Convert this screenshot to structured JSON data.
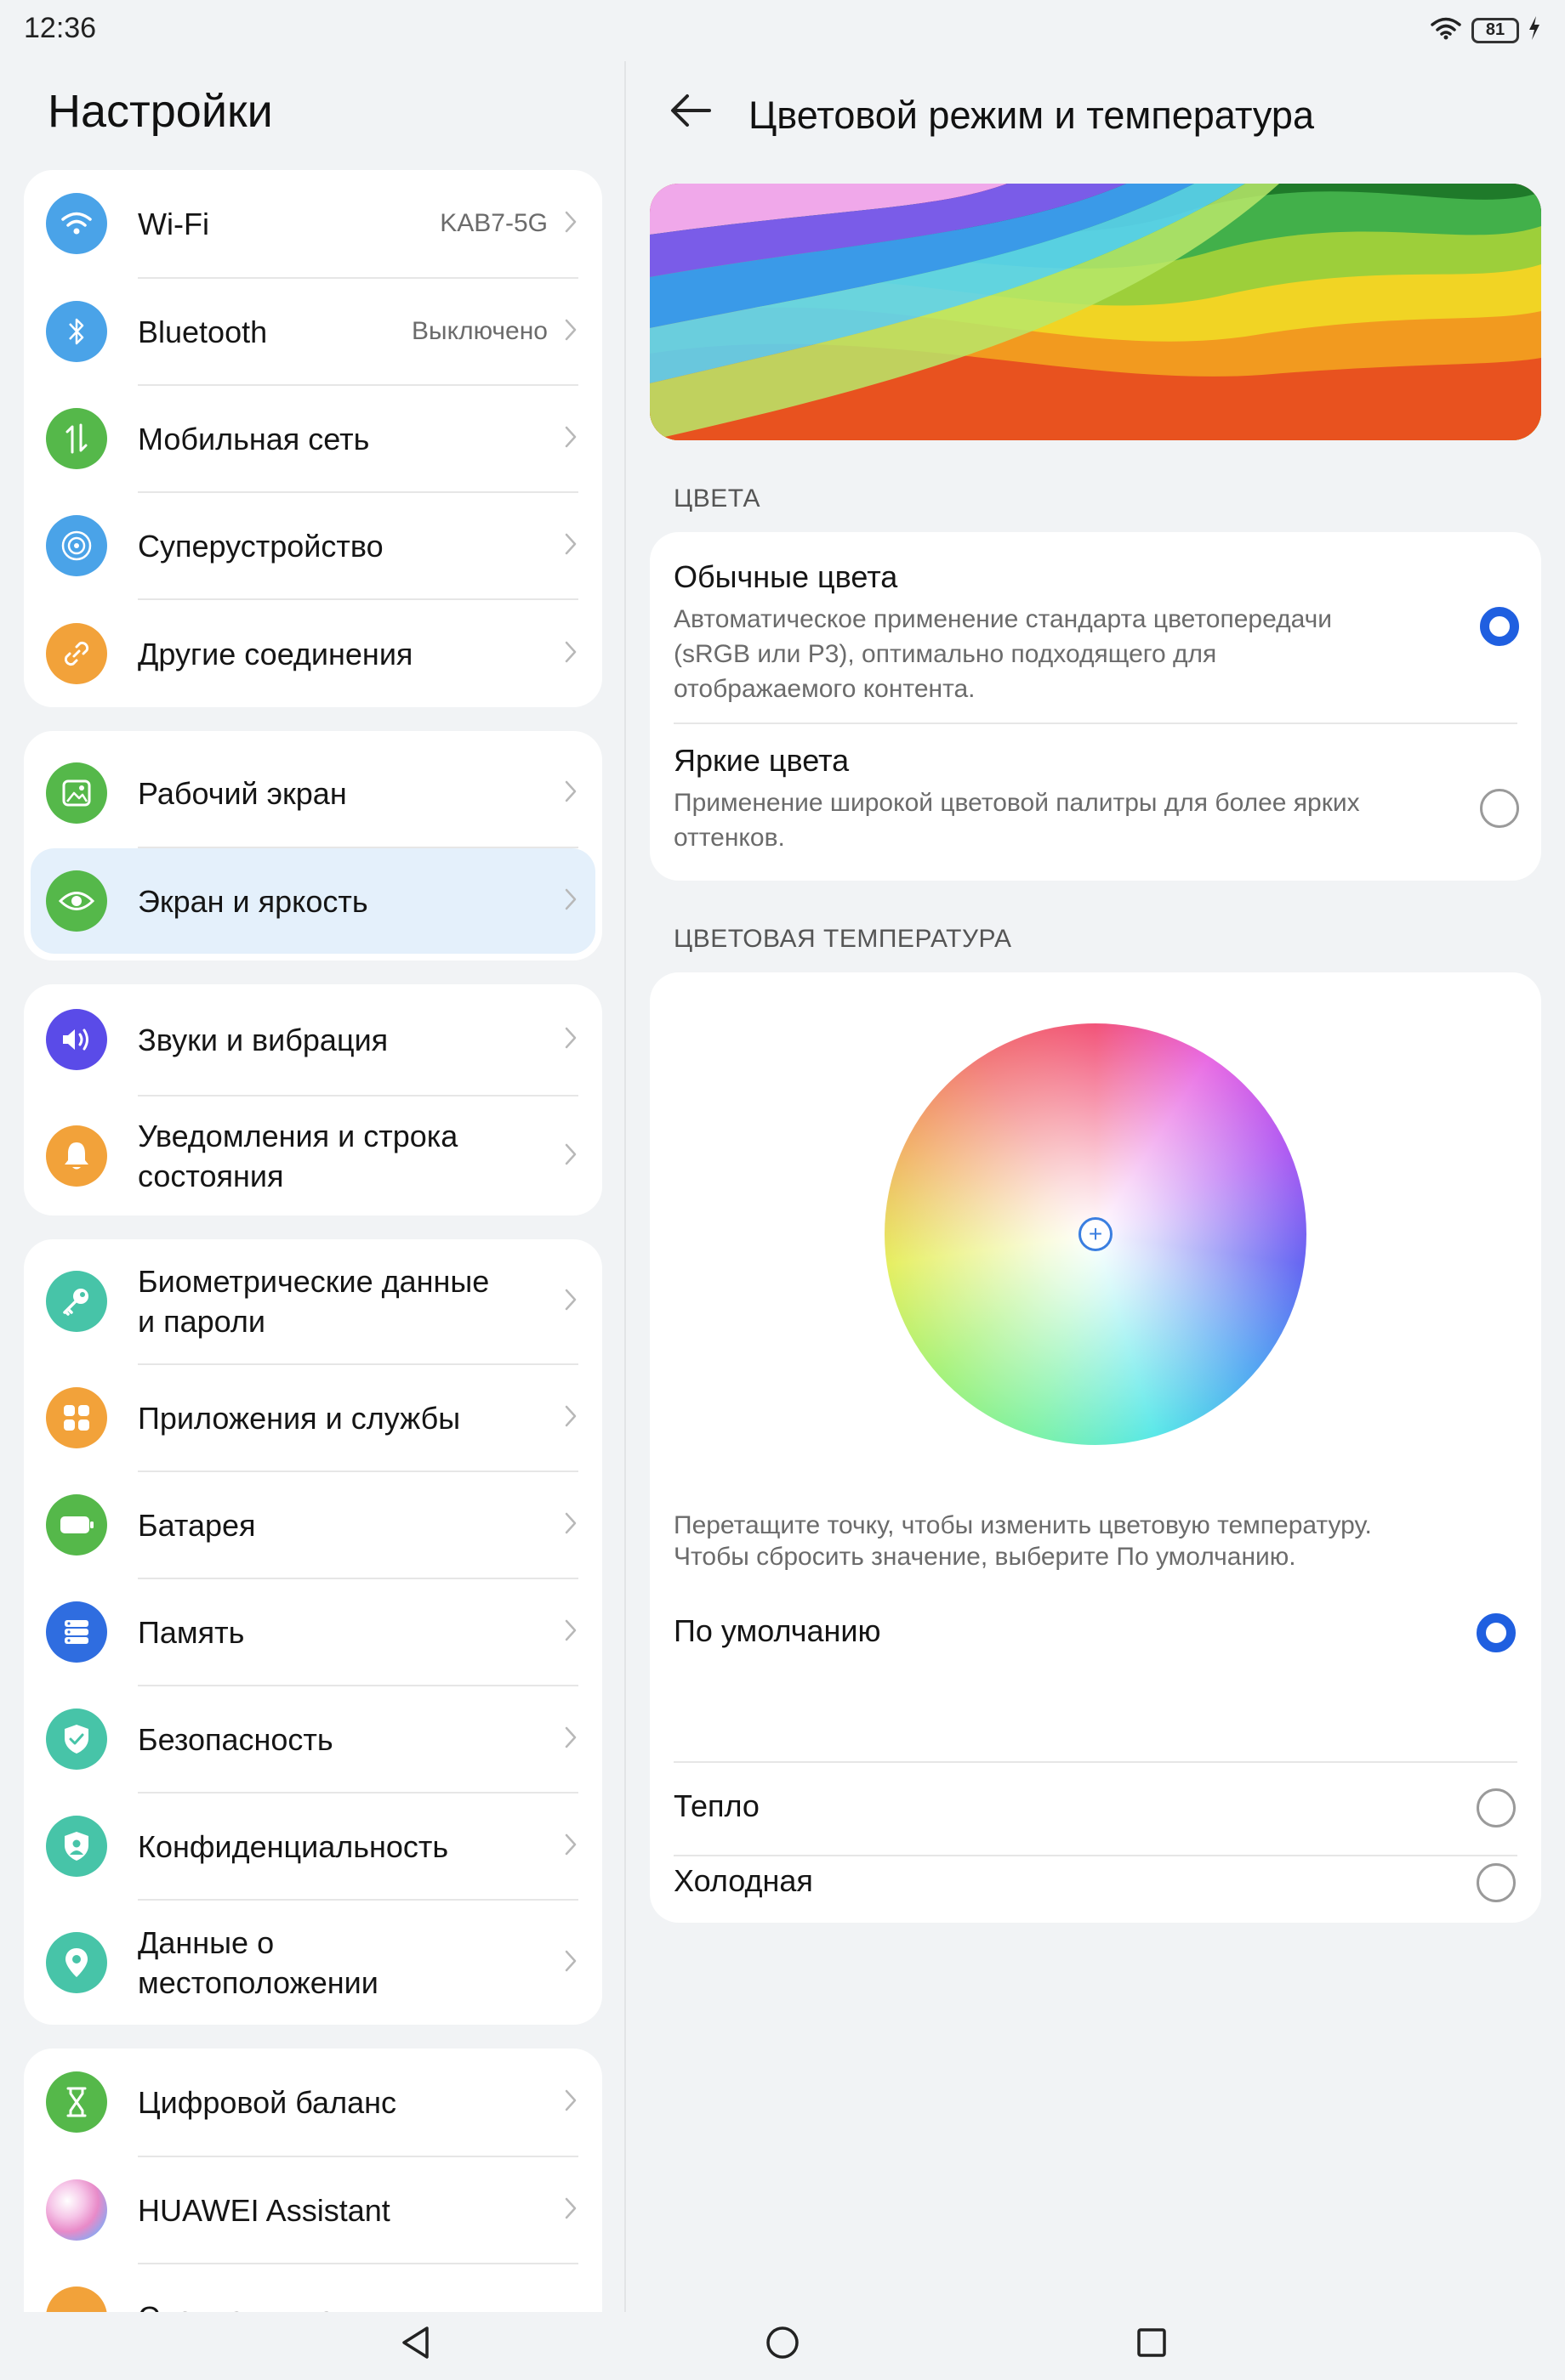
{
  "status_bar": {
    "time": "12:36",
    "battery": "81",
    "icons": [
      "wifi-icon",
      "battery-icon",
      "charging-icon"
    ]
  },
  "left_pane": {
    "title": "Настройки",
    "groups": [
      {
        "items": [
          {
            "label": "Wi-Fi",
            "value": "KAB7-5G",
            "icon": "wifi-icon",
            "color": "#4aa3e8"
          },
          {
            "label": "Bluetooth",
            "value": "Выключено",
            "icon": "bluetooth-icon",
            "color": "#4aa3e8"
          },
          {
            "label": "Мобильная сеть",
            "icon": "mobile-network-icon",
            "color": "#55b84a"
          },
          {
            "label": "Суперустройство",
            "icon": "super-device-icon",
            "color": "#4aa3e8"
          },
          {
            "label": "Другие соединения",
            "icon": "link-icon",
            "color": "#f2a23a"
          }
        ]
      },
      {
        "items": [
          {
            "label": "Рабочий экран",
            "icon": "wallpaper-icon",
            "color": "#55b84a"
          },
          {
            "label": "Экран и яркость",
            "icon": "eye-icon",
            "color": "#55b84a",
            "active": true
          }
        ]
      },
      {
        "items": [
          {
            "label": "Звуки и вибрация",
            "icon": "speaker-icon",
            "color": "#5a4be8"
          },
          {
            "label_lines": [
              "Уведомления и строка",
              "состояния"
            ],
            "icon": "bell-icon",
            "color": "#f2a23a"
          }
        ]
      },
      {
        "items": [
          {
            "label_lines": [
              "Биометрические данные",
              "и пароли"
            ],
            "icon": "key-icon",
            "color": "#47c4a8"
          },
          {
            "label": "Приложения и службы",
            "icon": "apps-icon",
            "color": "#f2a23a"
          },
          {
            "label": "Батарея",
            "icon": "battery-icon",
            "color": "#55b84a"
          },
          {
            "label": "Память",
            "icon": "storage-icon",
            "color": "#2f6de0"
          },
          {
            "label": "Безопасность",
            "icon": "shield-check-icon",
            "color": "#47c4a8"
          },
          {
            "label": "Конфиденциальность",
            "icon": "privacy-icon",
            "color": "#47c4a8"
          },
          {
            "label_lines": [
              "Данные о",
              "местоположении"
            ],
            "icon": "location-icon",
            "color": "#47c4a8"
          }
        ]
      },
      {
        "items": [
          {
            "label": "Цифровой баланс",
            "icon": "hourglass-icon",
            "color": "#55b84a"
          },
          {
            "label": "HUAWEI Assistant",
            "icon": "assistant-icon",
            "color": "#e88ac8"
          },
          {
            "label": "Специальные",
            "icon": "accessibility-icon",
            "color": "#f2a23a"
          }
        ]
      }
    ]
  },
  "right_pane": {
    "title": "Цветовой режим и температура",
    "colors_section": {
      "header": "ЦВЕТА",
      "options": [
        {
          "title": "Обычные цвета",
          "desc_lines": [
            "Автоматическое применение стандарта цветопередачи",
            "(sRGB или P3), оптимально подходящего для",
            "отображаемого контента."
          ],
          "selected": true
        },
        {
          "title": "Яркие цвета",
          "desc_lines": [
            "Применение широкой цветовой палитры для более ярких",
            "оттенков."
          ],
          "selected": false
        }
      ]
    },
    "temperature_section": {
      "header": "ЦВЕТОВАЯ ТЕМПЕРАТУРА",
      "hint_lines": [
        "Перетащите точку, чтобы изменить цветовую температуру.",
        "Чтобы сбросить значение, выберите По умолчанию."
      ],
      "options": [
        {
          "label": "По умолчанию",
          "selected": true
        },
        {
          "label": "Тепло",
          "selected": false
        },
        {
          "label": "Холодная",
          "selected": false
        }
      ]
    }
  },
  "accent_color": "#1f5fe0"
}
